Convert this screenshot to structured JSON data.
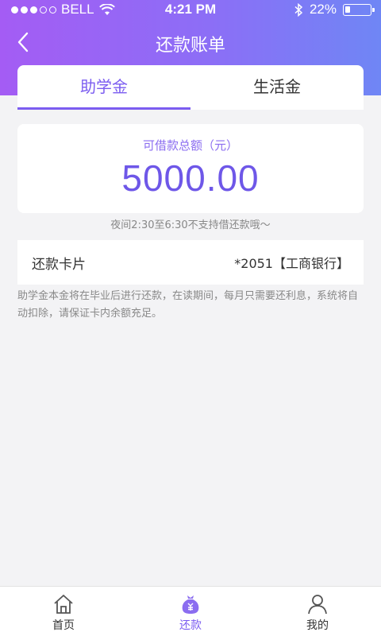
{
  "status_bar": {
    "carrier": "BELL",
    "time": "4:21 PM",
    "battery_percent": "22%",
    "battery_level": 0.22
  },
  "nav": {
    "title": "还款账单",
    "back_icon": "chevron-left-icon"
  },
  "tabs": [
    {
      "label": "助学金",
      "active": true
    },
    {
      "label": "生活金",
      "active": false
    }
  ],
  "amount": {
    "label": "可借款总额（元）",
    "value": "5000.00"
  },
  "notice": "夜间2:30至6:30不支持借还款哦～",
  "repay_card": {
    "label": "还款卡片",
    "value": "*2051【工商银行】"
  },
  "description": "助学金本金将在毕业后进行还款，在读期间，每月只需要还利息，系统将自动扣除，请保证卡内余额充足。",
  "tabbar": [
    {
      "label": "首页",
      "icon": "home-icon",
      "active": false
    },
    {
      "label": "还款",
      "icon": "money-bag-icon",
      "active": true
    },
    {
      "label": "我的",
      "icon": "user-icon",
      "active": false
    }
  ],
  "colors": {
    "accent": "#7b5cf0",
    "header_gradient_start": "#a45cf4",
    "header_gradient_end": "#6f86f5"
  }
}
